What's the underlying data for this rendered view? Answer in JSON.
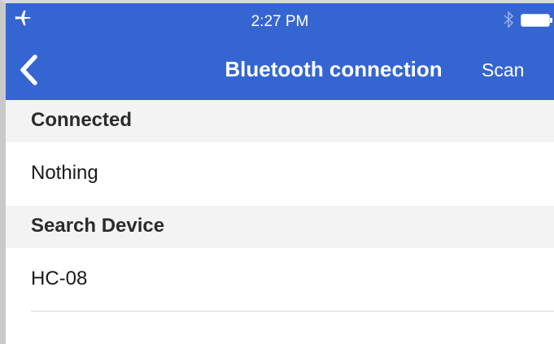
{
  "status_bar": {
    "time": "2:27 PM",
    "left_icon": "airplane-icon",
    "right_icons": [
      "bluetooth-icon",
      "battery-icon"
    ]
  },
  "nav_bar": {
    "title": "Bluetooth connection",
    "back_icon": "chevron-left-icon",
    "scan_label": "Scan"
  },
  "sections": {
    "connected": {
      "header": "Connected",
      "rows": [
        "Nothing"
      ]
    },
    "search": {
      "header": "Search Device",
      "rows": [
        "HC-08"
      ]
    }
  },
  "colors": {
    "header_background": "#3565d1",
    "section_background": "#f3f3f3",
    "row_background": "#ffffff",
    "divider": "#d5d5d5"
  }
}
